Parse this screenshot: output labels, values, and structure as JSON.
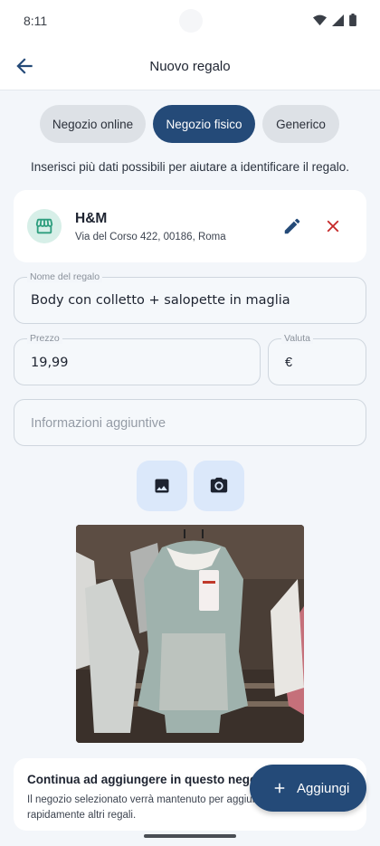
{
  "status_bar": {
    "time": "8:11",
    "icons": [
      "wifi-icon",
      "signal-icon",
      "battery-icon"
    ]
  },
  "app_bar": {
    "title": "Nuovo regalo",
    "back_icon": "arrow-back-icon"
  },
  "tabs": [
    {
      "label": "Negozio online",
      "selected": false
    },
    {
      "label": "Negozio fisico",
      "selected": true
    },
    {
      "label": "Generico",
      "selected": false
    }
  ],
  "hint": "Inserisci più dati possibili per aiutare a identificare il regalo.",
  "store": {
    "name": "H&M",
    "address": "Via del Corso 422, 00186, Roma",
    "icon": "storefront-icon",
    "edit_icon": "pencil-icon",
    "delete_icon": "close-icon"
  },
  "form": {
    "name_label": "Nome del regalo",
    "name_value": "Body con colletto + salopette in maglia",
    "price_label": "Prezzo",
    "price_value": "19,99",
    "currency_label": "Valuta",
    "currency_value": "€",
    "info_placeholder": "Informazioni aggiuntive"
  },
  "media_buttons": {
    "gallery_icon": "image-icon",
    "camera_icon": "camera-icon"
  },
  "bottom_card": {
    "title": "Continua ad aggiungere in questo negozio",
    "text": "Il negozio selezionato verrà mantenuto per aggiungere rapidamente altri regali."
  },
  "fab": {
    "label": "Aggiungi",
    "icon": "plus-icon"
  },
  "colors": {
    "primary": "#244a78",
    "delete": "#c62828",
    "store_icon": "#2e9e7e",
    "surface": "#f3f6fa"
  }
}
